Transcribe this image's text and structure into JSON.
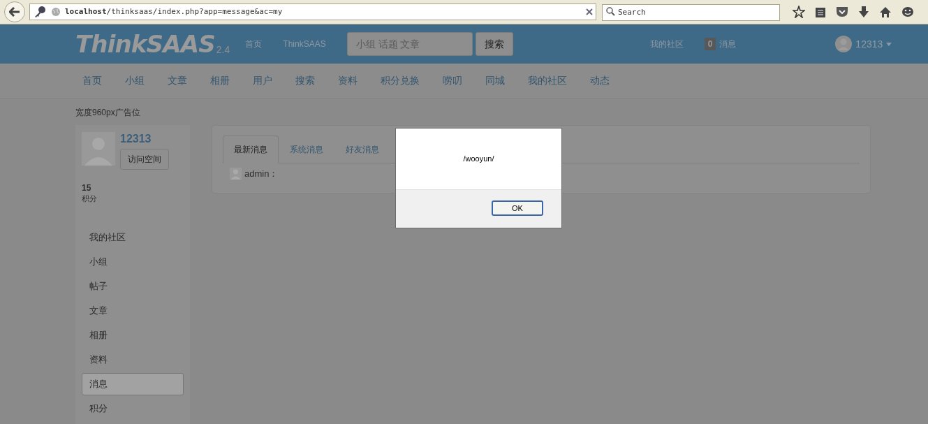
{
  "browser": {
    "url": "**localhost**/thinksaas/index.php?app=message&ac=my",
    "search": {
      "placeholder": "Search"
    }
  },
  "header": {
    "logo": "ThinkSAAS",
    "version": "2.4",
    "links": [
      "首页",
      "ThinkSAAS"
    ],
    "search": {
      "placeholder": "小组 话题 文章",
      "button": "搜索"
    },
    "community": "我的社区",
    "message_count": "0",
    "message_label": "消息",
    "username": "12313"
  },
  "nav": [
    "首页",
    "小组",
    "文章",
    "相册",
    "用户",
    "搜索",
    "资料",
    "积分兑换",
    "唠叨",
    "同城",
    "我的社区",
    "动态"
  ],
  "ad": "宽度960px广告位",
  "profile": {
    "name": "12313",
    "button": "访问空间",
    "score": "15",
    "score_label": "积分"
  },
  "sidebar": {
    "items": [
      {
        "label": "我的社区",
        "selected": false
      },
      {
        "label": "小组",
        "selected": false
      },
      {
        "label": "帖子",
        "selected": false
      },
      {
        "label": "文章",
        "selected": false
      },
      {
        "label": "相册",
        "selected": false
      },
      {
        "label": "资料",
        "selected": false
      },
      {
        "label": "消息",
        "selected": true
      },
      {
        "label": "积分",
        "selected": false
      }
    ]
  },
  "tabs": [
    {
      "label": "最新消息",
      "selected": true
    },
    {
      "label": "系统消息",
      "selected": false
    },
    {
      "label": "好友消息",
      "selected": false
    }
  ],
  "messages": [
    {
      "sender": "admin："
    }
  ],
  "dialog": {
    "message": "/wooyun/",
    "button": "OK"
  }
}
